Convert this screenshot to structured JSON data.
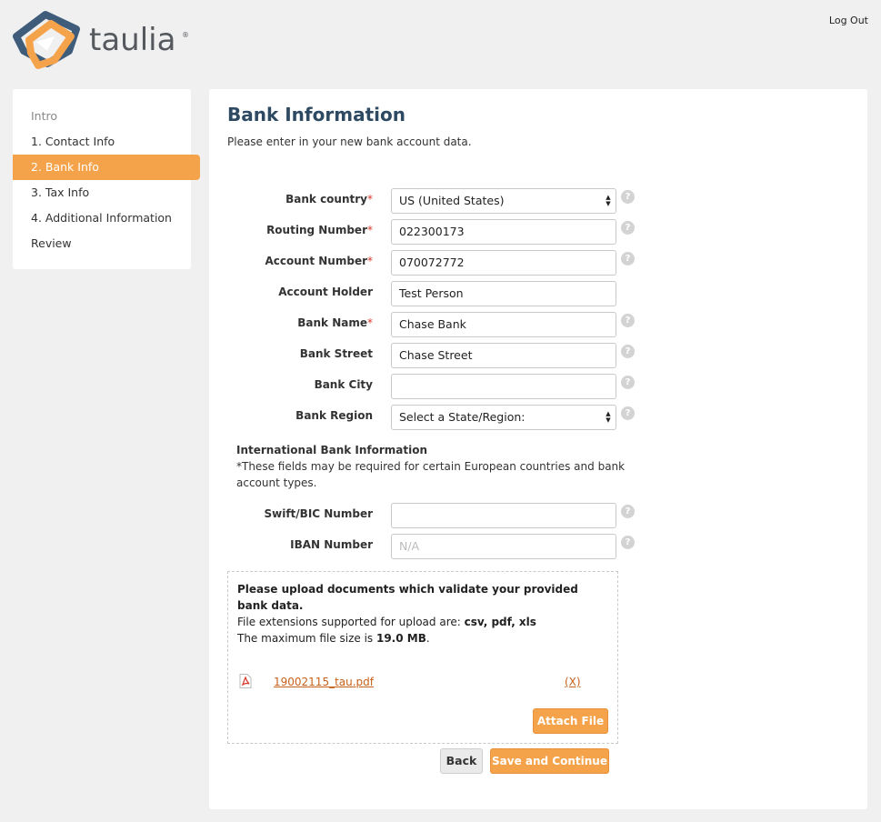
{
  "brand": {
    "name": "taulia",
    "reg_mark": "®",
    "colors": {
      "orange": "#f5a34a",
      "navy": "#2e4a63",
      "gray": "#55595e"
    }
  },
  "header": {
    "logout_label": "Log Out"
  },
  "sidebar": {
    "items": [
      {
        "label": "Intro",
        "state": "muted"
      },
      {
        "label": "1. Contact Info",
        "state": "normal"
      },
      {
        "label": "2. Bank Info",
        "state": "active"
      },
      {
        "label": "3. Tax Info",
        "state": "normal"
      },
      {
        "label": "4. Additional Information",
        "state": "normal"
      },
      {
        "label": "Review",
        "state": "normal"
      }
    ]
  },
  "main": {
    "title": "Bank Information",
    "subtitle": "Please enter in your new bank account data."
  },
  "form": {
    "required_mark": "*",
    "fields": [
      {
        "label": "Bank country",
        "required": true,
        "type": "select",
        "value": "US (United States)",
        "help": true
      },
      {
        "label": "Routing Number",
        "required": true,
        "type": "text",
        "value": "022300173",
        "help": true
      },
      {
        "label": "Account Number",
        "required": true,
        "type": "text",
        "value": "070072772",
        "help": true
      },
      {
        "label": "Account Holder",
        "required": false,
        "type": "text",
        "value": "Test Person",
        "help": false
      },
      {
        "label": "Bank Name",
        "required": true,
        "type": "text",
        "value": "Chase Bank",
        "help": true
      },
      {
        "label": "Bank Street",
        "required": false,
        "type": "text",
        "value": "Chase Street",
        "help": true
      },
      {
        "label": "Bank City",
        "required": false,
        "type": "text",
        "value": "",
        "help": true
      },
      {
        "label": "Bank Region",
        "required": false,
        "type": "select",
        "value": "Select a State/Region:",
        "help": true
      }
    ],
    "help_glyph": "?"
  },
  "international": {
    "title": "International Bank Information",
    "note": "*These fields may be required for certain European countries and bank account types.",
    "fields": [
      {
        "label": "Swift/BIC Number",
        "type": "text",
        "value": "",
        "placeholder": "",
        "help": true
      },
      {
        "label": "IBAN Number",
        "type": "text",
        "value": "",
        "placeholder": "N/A",
        "help": true
      }
    ]
  },
  "upload": {
    "heading": "Please upload documents which validate your provided bank data.",
    "extensions_prefix": "File extensions supported for upload are: ",
    "extensions": "csv, pdf, xls",
    "max_size_prefix": "The maximum file size is ",
    "max_size": "19.0 MB",
    "max_size_suffix": ".",
    "file_name": "19002115_tau.pdf",
    "file_icon": "pdf-icon",
    "remove_label": "(X)",
    "attach_label": "Attach File"
  },
  "actions": {
    "back_label": "Back",
    "save_label": "Save and Continue"
  }
}
